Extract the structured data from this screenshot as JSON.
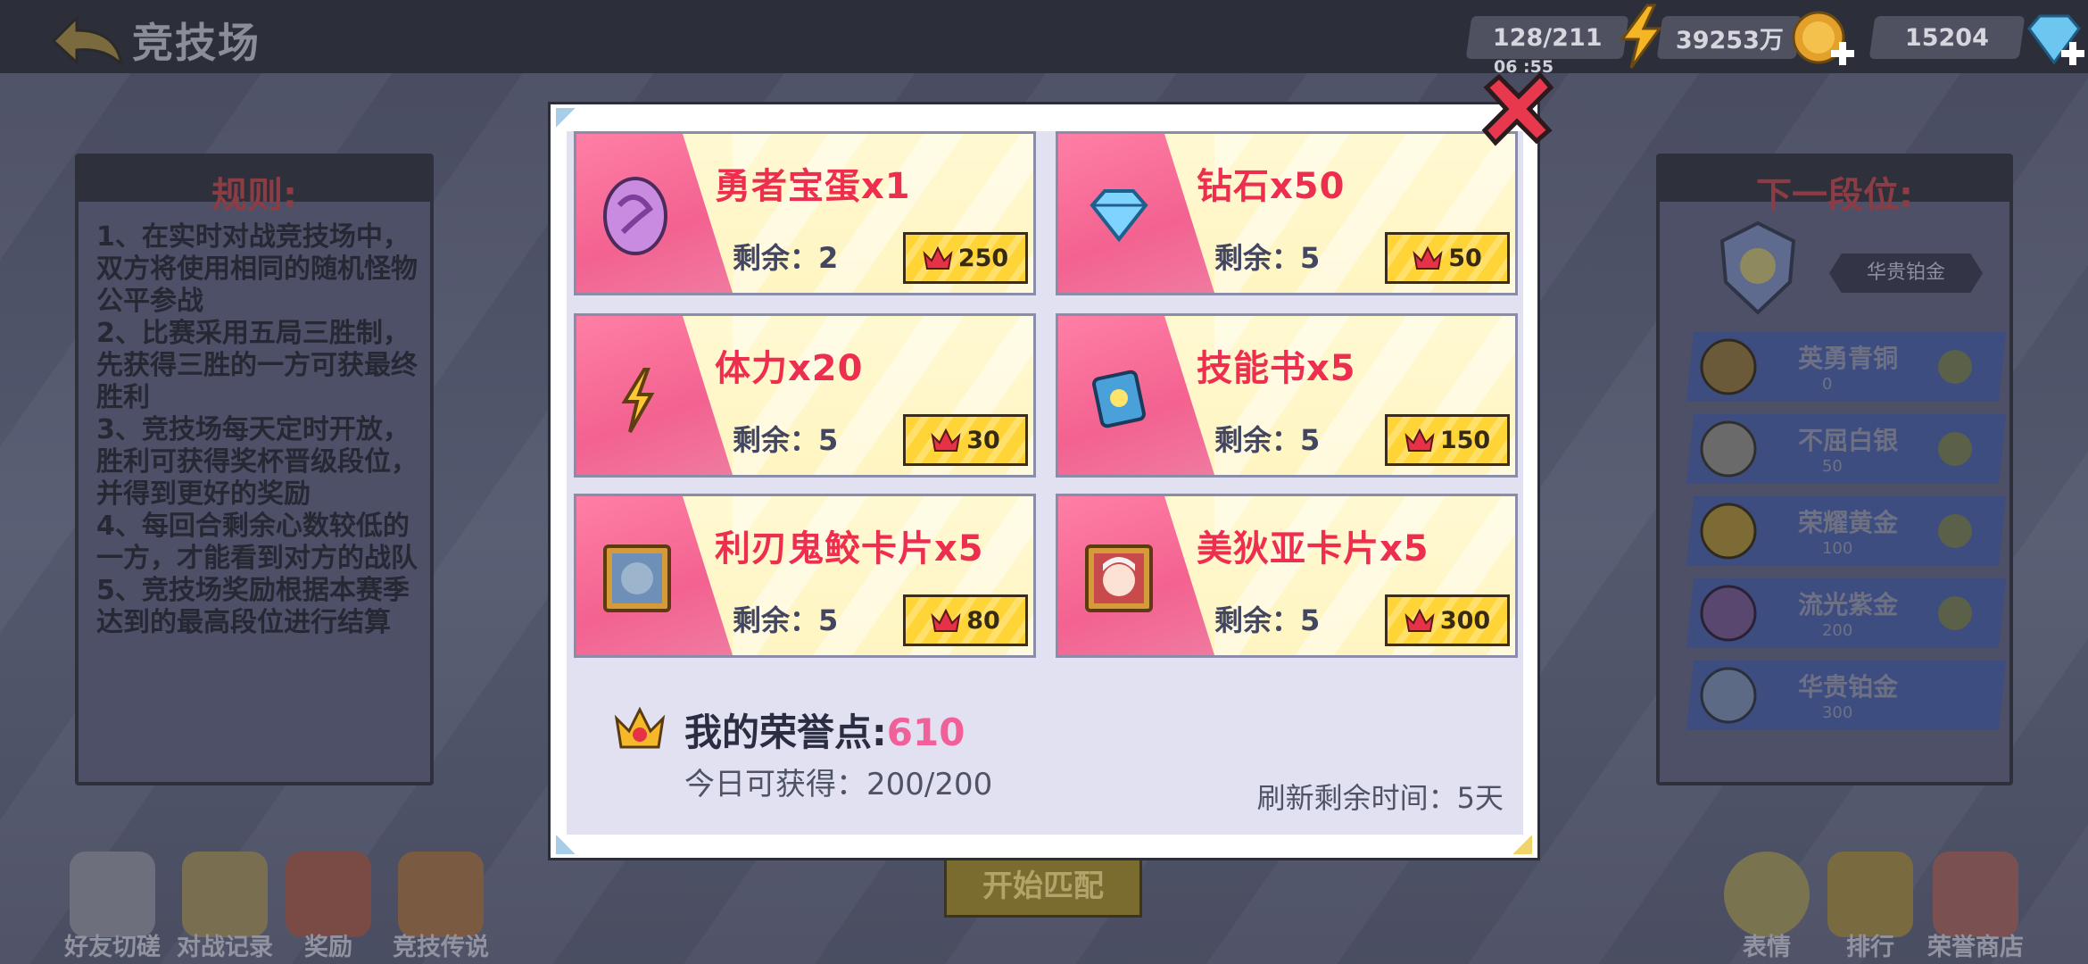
{
  "topbar": {
    "title": "竞技场",
    "stamina": "128/211",
    "stamina_timer": "06 :55",
    "gold": "39253万",
    "gems": "15204"
  },
  "rules": {
    "title": "规则:",
    "lines": [
      "1、在实时对战竞技场中，双方将使用相同的随机怪物公平参战",
      "2、比赛采用五局三胜制，先获得三胜的一方可获最终胜利",
      "3、竞技场每天定时开放，胜利可获得奖杯晋级段位，并得到更好的奖励",
      "4、每回合剩余心数较低的一方，才能看到对方的战队",
      "5、竞技场奖励根据本赛季达到的最高段位进行结算"
    ]
  },
  "next_rank": {
    "title": "下一段位:",
    "label": "华贵铂金",
    "ranks": [
      {
        "name": "英勇青铜",
        "points": "0"
      },
      {
        "name": "不屈白银",
        "points": "50"
      },
      {
        "name": "荣耀黄金",
        "points": "100"
      },
      {
        "name": "流光紫金",
        "points": "200"
      },
      {
        "name": "华贵铂金",
        "points": "300"
      }
    ]
  },
  "bottom_nav": {
    "friend_battle": "好友切磋",
    "battle_record": "对战记录",
    "rewards": "奖励",
    "legend": "竞技传说",
    "start_match": "开始匹配",
    "emotes": "表情",
    "ranking": "排行",
    "honor_shop": "荣誉商店"
  },
  "shop": {
    "remain_prefix": "剩余：",
    "items": [
      {
        "name": "勇者宝蛋x1",
        "remain": "2",
        "price": "250",
        "icon": "egg-icon"
      },
      {
        "name": "钻石x50",
        "remain": "5",
        "price": "50",
        "icon": "diamond-icon"
      },
      {
        "name": "体力x20",
        "remain": "5",
        "price": "30",
        "icon": "stamina-bolt-icon"
      },
      {
        "name": "技能书x5",
        "remain": "5",
        "price": "150",
        "icon": "skill-book-icon"
      },
      {
        "name": "利刃鬼鲛卡片x5",
        "remain": "5",
        "price": "80",
        "icon": "shark-card-icon"
      },
      {
        "name": "美狄亚卡片x5",
        "remain": "5",
        "price": "300",
        "icon": "medea-card-icon"
      }
    ],
    "honor_label": "我的荣誉点:",
    "honor_value": "610",
    "today_label": "今日可获得：200/200",
    "refresh_label": "刷新剩余时间：5天"
  },
  "colors": {
    "accent_pink": "#f36290",
    "title_red": "#ee2e4e",
    "price_yellow": "#ffd437",
    "honor_pink": "#f2609a"
  }
}
